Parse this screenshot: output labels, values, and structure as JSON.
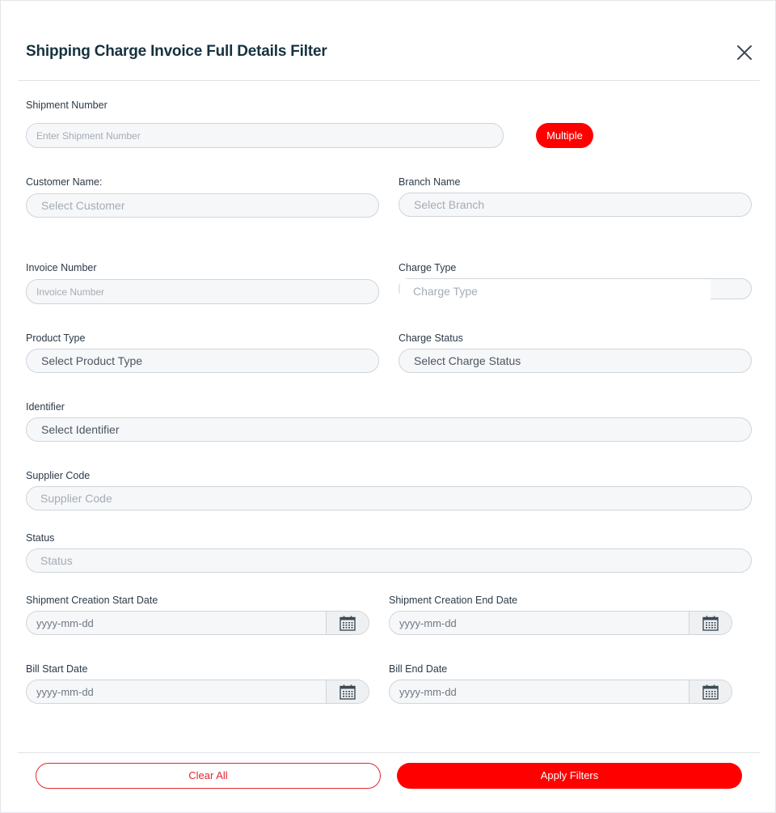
{
  "header": {
    "title": "Shipping Charge Invoice Full Details Filter"
  },
  "fields": {
    "shipment_number": {
      "label": "Shipment Number",
      "placeholder": "Enter Shipment Number",
      "multiple_label": "Multiple"
    },
    "customer_name": {
      "label": "Customer Name:",
      "placeholder": "Select Customer"
    },
    "branch_name": {
      "label": "Branch Name",
      "placeholder": "Select Branch"
    },
    "invoice_number": {
      "label": "Invoice Number",
      "placeholder": "Invoice Number"
    },
    "charge_type": {
      "label": "Charge Type",
      "placeholder": "Charge Type"
    },
    "product_type": {
      "label": "Product Type",
      "placeholder": "Select Product Type"
    },
    "charge_status": {
      "label": "Charge Status",
      "placeholder": "Select Charge Status"
    },
    "identifier": {
      "label": "Identifier",
      "placeholder": "Select Identifier"
    },
    "supplier_code": {
      "label": "Supplier Code",
      "placeholder": "Supplier Code"
    },
    "status": {
      "label": "Status",
      "placeholder": "Status"
    },
    "creation_start_date": {
      "label": "Shipment Creation Start Date",
      "placeholder": "yyyy-mm-dd"
    },
    "creation_end_date": {
      "label": "Shipment Creation End Date",
      "placeholder": "yyyy-mm-dd"
    },
    "bill_start_date": {
      "label": "Bill Start Date",
      "placeholder": "yyyy-mm-dd"
    },
    "bill_end_date": {
      "label": "Bill End Date",
      "placeholder": "yyyy-mm-dd"
    }
  },
  "footer": {
    "clear_label": "Clear All",
    "apply_label": "Apply Filters"
  },
  "colors": {
    "accent": "#ff0000",
    "title": "#16323f",
    "border": "#cfd5db",
    "field_bg": "#f6f7f9"
  },
  "icons": {
    "close": "close-icon",
    "calendar": "calendar-icon"
  }
}
